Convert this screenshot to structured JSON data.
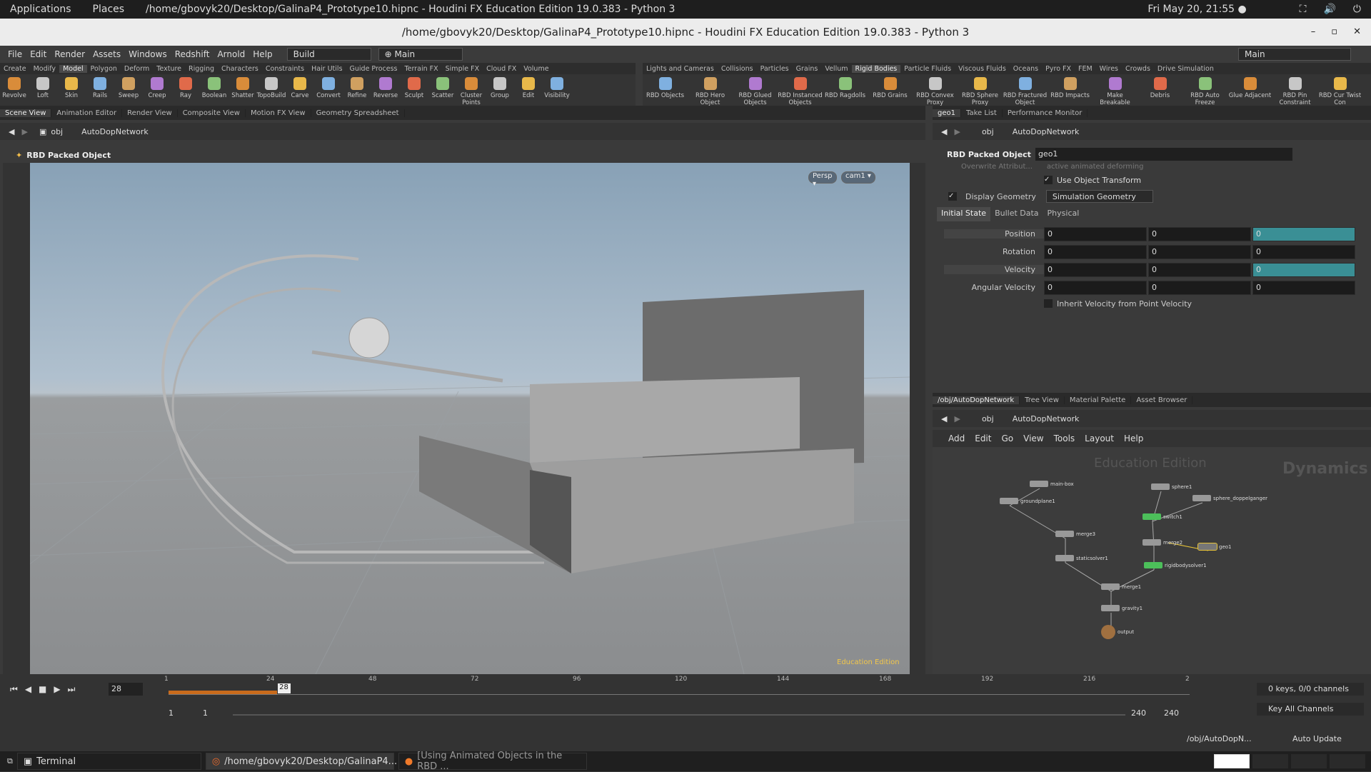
{
  "gnome": {
    "apps": "Applications",
    "places": "Places",
    "window": "/home/gbovyk20/Desktop/GalinaP4_Prototype10.hipnc - Houdini FX Education Edition 19.0.383 - Python 3",
    "clock": "Fri May 20, 21:55 ●"
  },
  "title": "/home/gbovyk20/Desktop/GalinaP4_Prototype10.hipnc - Houdini FX Education Edition 19.0.383 - Python 3",
  "menu": [
    "File",
    "Edit",
    "Render",
    "Assets",
    "Windows",
    "Redshift",
    "Arnold",
    "Help"
  ],
  "desktops": {
    "build": "Build",
    "main": "Main",
    "main_right": "Main"
  },
  "shelf_left_tabs": [
    "Create",
    "Modify",
    "Model",
    "Polygon",
    "Deform",
    "Texture",
    "Rigging",
    "Characters",
    "Constraints",
    "Hair Utils",
    "Guide Process",
    "Terrain FX",
    "Simple FX",
    "Cloud FX",
    "Volume"
  ],
  "shelf_left_tools": [
    "Revolve",
    "Loft",
    "Skin",
    "Rails",
    "Sweep",
    "Creep",
    "Ray",
    "Boolean",
    "Shatter",
    "TopoBuild",
    "Carve",
    "Convert",
    "Refine",
    "Reverse",
    "Sculpt",
    "Scatter",
    "Cluster Points",
    "Group",
    "Edit",
    "Visibility"
  ],
  "shelf_right_tabs": [
    "Lights and Cameras",
    "Collisions",
    "Particles",
    "Grains",
    "Vellum",
    "Rigid Bodies",
    "Particle Fluids",
    "Viscous Fluids",
    "Oceans",
    "Pyro FX",
    "FEM",
    "Wires",
    "Crowds",
    "Drive Simulation"
  ],
  "shelf_right_tools": [
    "RBD Objects",
    "RBD Hero Object",
    "RBD Glued Objects",
    "RBD Instanced Objects",
    "RBD Ragdolls",
    "RBD Grains",
    "RBD Convex Proxy",
    "RBD Sphere Proxy",
    "RBD Fractured Object",
    "RBD Impacts",
    "Make Breakable",
    "Debris",
    "RBD Auto Freeze",
    "Glue Adjacent",
    "RBD Pin Constraint",
    "RBD Cur Twist Con"
  ],
  "pane_tabs_left": [
    "Scene View",
    "Animation Editor",
    "Render View",
    "Composite View",
    "Motion FX View",
    "Geometry Spreadsheet"
  ],
  "path": {
    "obj": "obj",
    "net": "AutoDopNetwork"
  },
  "viewport": {
    "title": "RBD Packed Object",
    "persp": "Persp ▾",
    "cam": "cam1 ▾",
    "edu": "Education Edition"
  },
  "pane_tabs_right": [
    "geo1",
    "Take List",
    "Performance Monitor"
  ],
  "params": {
    "type": "RBD Packed Object",
    "name": "geo1",
    "cut": "Overwrite Attribut...",
    "cut_val": "active animated deforming",
    "use_xform": "Use Object Transform",
    "display_geo": "Display Geometry",
    "display_val": "Simulation Geometry",
    "tabs": [
      "Initial State",
      "Bullet Data",
      "Physical"
    ],
    "rows": [
      {
        "label": "Position",
        "v": [
          "0",
          "0",
          "0"
        ]
      },
      {
        "label": "Rotation",
        "v": [
          "0",
          "0",
          "0"
        ]
      },
      {
        "label": "Velocity",
        "v": [
          "0",
          "0",
          "0"
        ]
      },
      {
        "label": "Angular Velocity",
        "v": [
          "0",
          "0",
          "0"
        ]
      }
    ],
    "inherit": "Inherit Velocity from Point Velocity"
  },
  "net_tabs": [
    "/obj/AutoDopNetwork",
    "Tree View",
    "Material Palette",
    "Asset Browser"
  ],
  "net_menu": [
    "Add",
    "Edit",
    "Go",
    "View",
    "Tools",
    "Layout",
    "Help"
  ],
  "net_watermark": {
    "edu": "Education Edition",
    "dyn": "Dynamics"
  },
  "nodes": [
    "main-box",
    "groundplane1",
    "merge3",
    "staticsolver1",
    "sphere1",
    "sphere_doppelganger",
    "switch1",
    "merge2",
    "geo1",
    "rigidbodysolver1",
    "merge1",
    "gravity1",
    "output"
  ],
  "timeline": {
    "frame": "28",
    "marker": "28",
    "ticks": [
      "1",
      "24",
      "48",
      "72",
      "96",
      "120",
      "144",
      "168",
      "192",
      "216",
      "2"
    ],
    "start": "1",
    "start2": "1",
    "end": "240",
    "end2": "240",
    "keys": "0 keys, 0/0 channels",
    "keyall": "Key All Channels",
    "objpath": "/obj/AutoDopN...",
    "update": "Auto Update"
  },
  "taskbar": [
    "Terminal",
    "/home/gbovyk20/Desktop/GalinaP4...",
    "[Using Animated Objects in the RBD ..."
  ]
}
